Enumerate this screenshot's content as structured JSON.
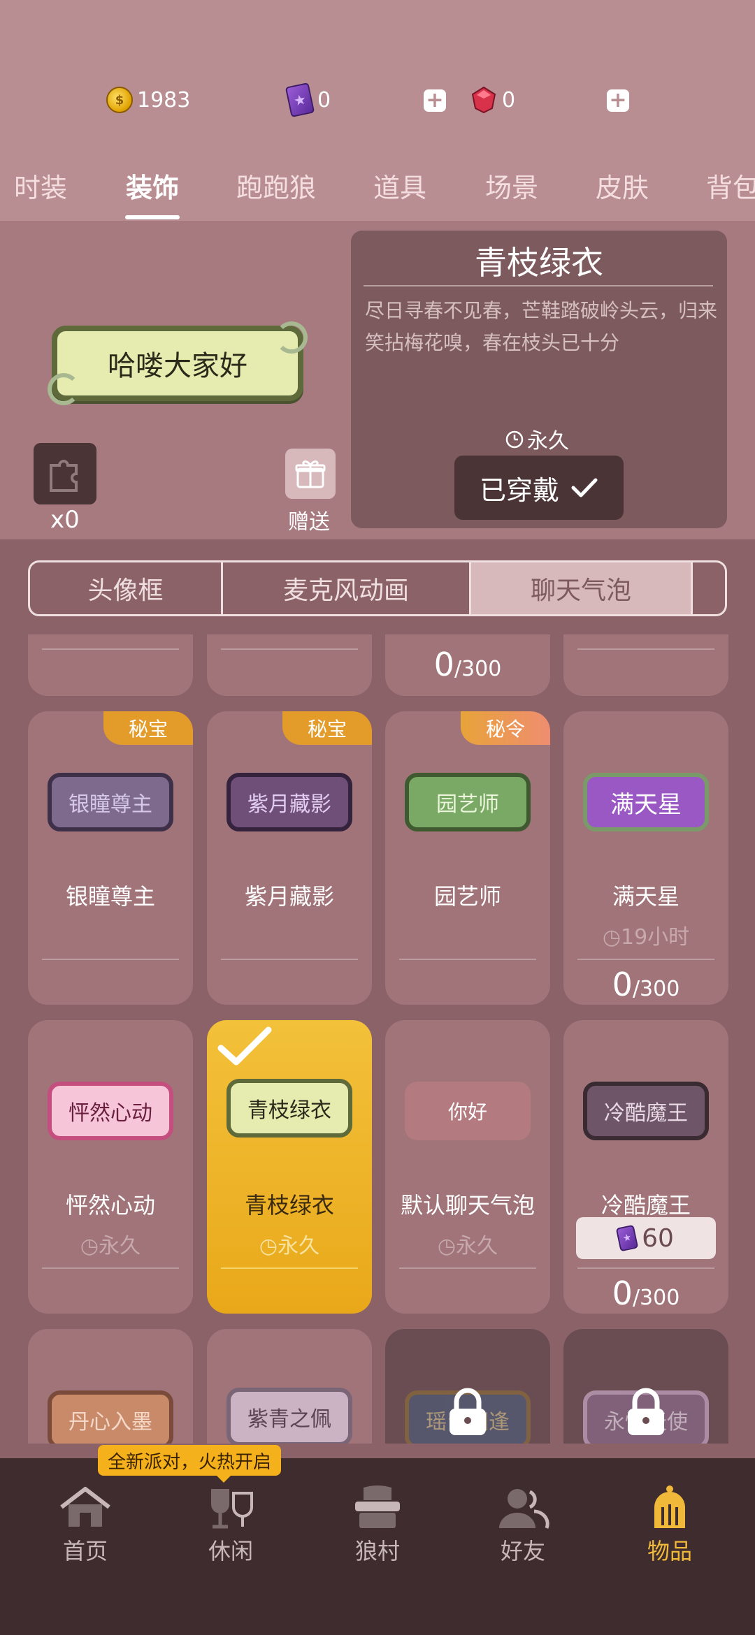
{
  "currencies": {
    "gold": "1983",
    "cards": "0",
    "gems": "0"
  },
  "tabs": [
    "时装",
    "装饰",
    "跑跑狼",
    "道具",
    "场景",
    "皮肤",
    "背包"
  ],
  "preview": {
    "bubble_text": "哈喽大家好",
    "puzzle_count": "x0",
    "gift_label": "赠送",
    "item_title": "青枝绿衣",
    "item_description": "尽日寻春不见春，芒鞋踏破岭头云，归来笑拈梅花嗅，春在枝头已十分",
    "duration": "永久",
    "worn_label": "已穿戴"
  },
  "subtabs": [
    "头像框",
    "麦克风动画",
    "聊天气泡"
  ],
  "items": {
    "row0": {
      "progress_c": "0",
      "progress_total": "/300"
    },
    "row1": [
      {
        "tag": "秘宝",
        "bubble": "银瞳尊主",
        "name": "银瞳尊主"
      },
      {
        "tag": "秘宝",
        "bubble": "紫月藏影",
        "name": "紫月藏影"
      },
      {
        "tag": "秘令",
        "bubble": "园艺师",
        "name": "园艺师"
      },
      {
        "bubble": "满天星",
        "name": "满天星",
        "time": "19小时",
        "progress": "0",
        "progress_total": "/300"
      }
    ],
    "row2": [
      {
        "bubble": "怦然心动",
        "name": "怦然心动",
        "time": "永久"
      },
      {
        "bubble": "青枝绿衣",
        "name": "青枝绿衣",
        "time": "永久"
      },
      {
        "bubble": "你好",
        "name": "默认聊天气泡",
        "time": "永久"
      },
      {
        "bubble": "冷酷魔王",
        "name": "冷酷魔王",
        "price": "60",
        "progress": "0",
        "progress_total": "/300"
      }
    ],
    "row3": [
      {
        "bubble": "丹心入墨"
      },
      {
        "bubble": "紫青之佩"
      },
      {
        "bubble": "瑶台相逢"
      },
      {
        "bubble": "永恒天使"
      }
    ]
  },
  "promo": "全新派对，火热开启",
  "bottom_nav": [
    "首页",
    "休闲",
    "狼村",
    "好友",
    "物品"
  ],
  "colors": {
    "header_bg": "#b88e93",
    "selected_card": "#f3c13a",
    "active_nav": "#f0b93a"
  }
}
